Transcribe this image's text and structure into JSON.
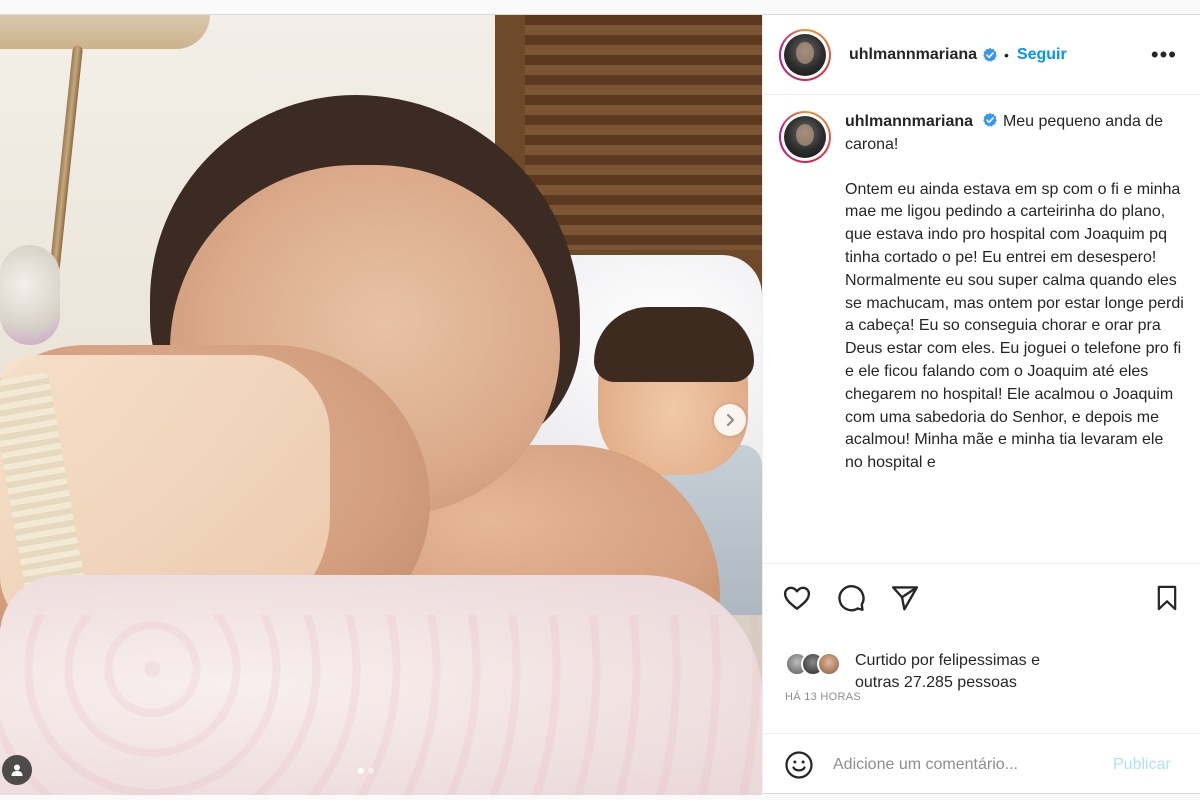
{
  "post": {
    "username": "uhlmannmariana",
    "follow_label": "Seguir",
    "bullet": "•",
    "more_label": "•••",
    "caption": {
      "username": "uhlmannmariana",
      "headline": "Meu pequeno anda de carona!",
      "body": "Ontem eu ainda estava em sp com o fi e minha mae me ligou pedindo a carteirinha do plano, que estava indo pro hospital com Joaquim pq tinha cortado o pe! Eu entrei em desespero! Normalmente eu sou super calma quando eles se machucam, mas ontem por estar longe perdi a cabeça! Eu so conseguia chorar e orar pra Deus estar com eles. Eu joguei o telefone pro fi e ele ficou falando com o Joaquim até eles chegarem no hospital! Ele acalmou o Joaquim com uma sabedoria do Senhor, e depois me acalmou! Minha mãe e minha tia levaram ele no hospital e"
    },
    "likes": {
      "line1": "Curtido por felipessimas e",
      "line2": "outras 27.285 pessoas"
    },
    "timestamp": "HÁ 13 HORAS",
    "comment": {
      "placeholder": "Adicione um comentário...",
      "publish_label": "Publicar"
    },
    "carousel": {
      "total": 2,
      "current": 1
    },
    "icons": {
      "like": "heart-icon",
      "comment": "comment-icon",
      "share": "share-icon",
      "save": "bookmark-icon",
      "emoji": "emoji-icon",
      "next": "chevron-right-icon",
      "tag": "user-tag-icon",
      "verified": "verified-badge-icon"
    },
    "colors": {
      "accent": "#0095f6",
      "publish_disabled": "#b2dffc",
      "verified": "#3897f0"
    }
  }
}
